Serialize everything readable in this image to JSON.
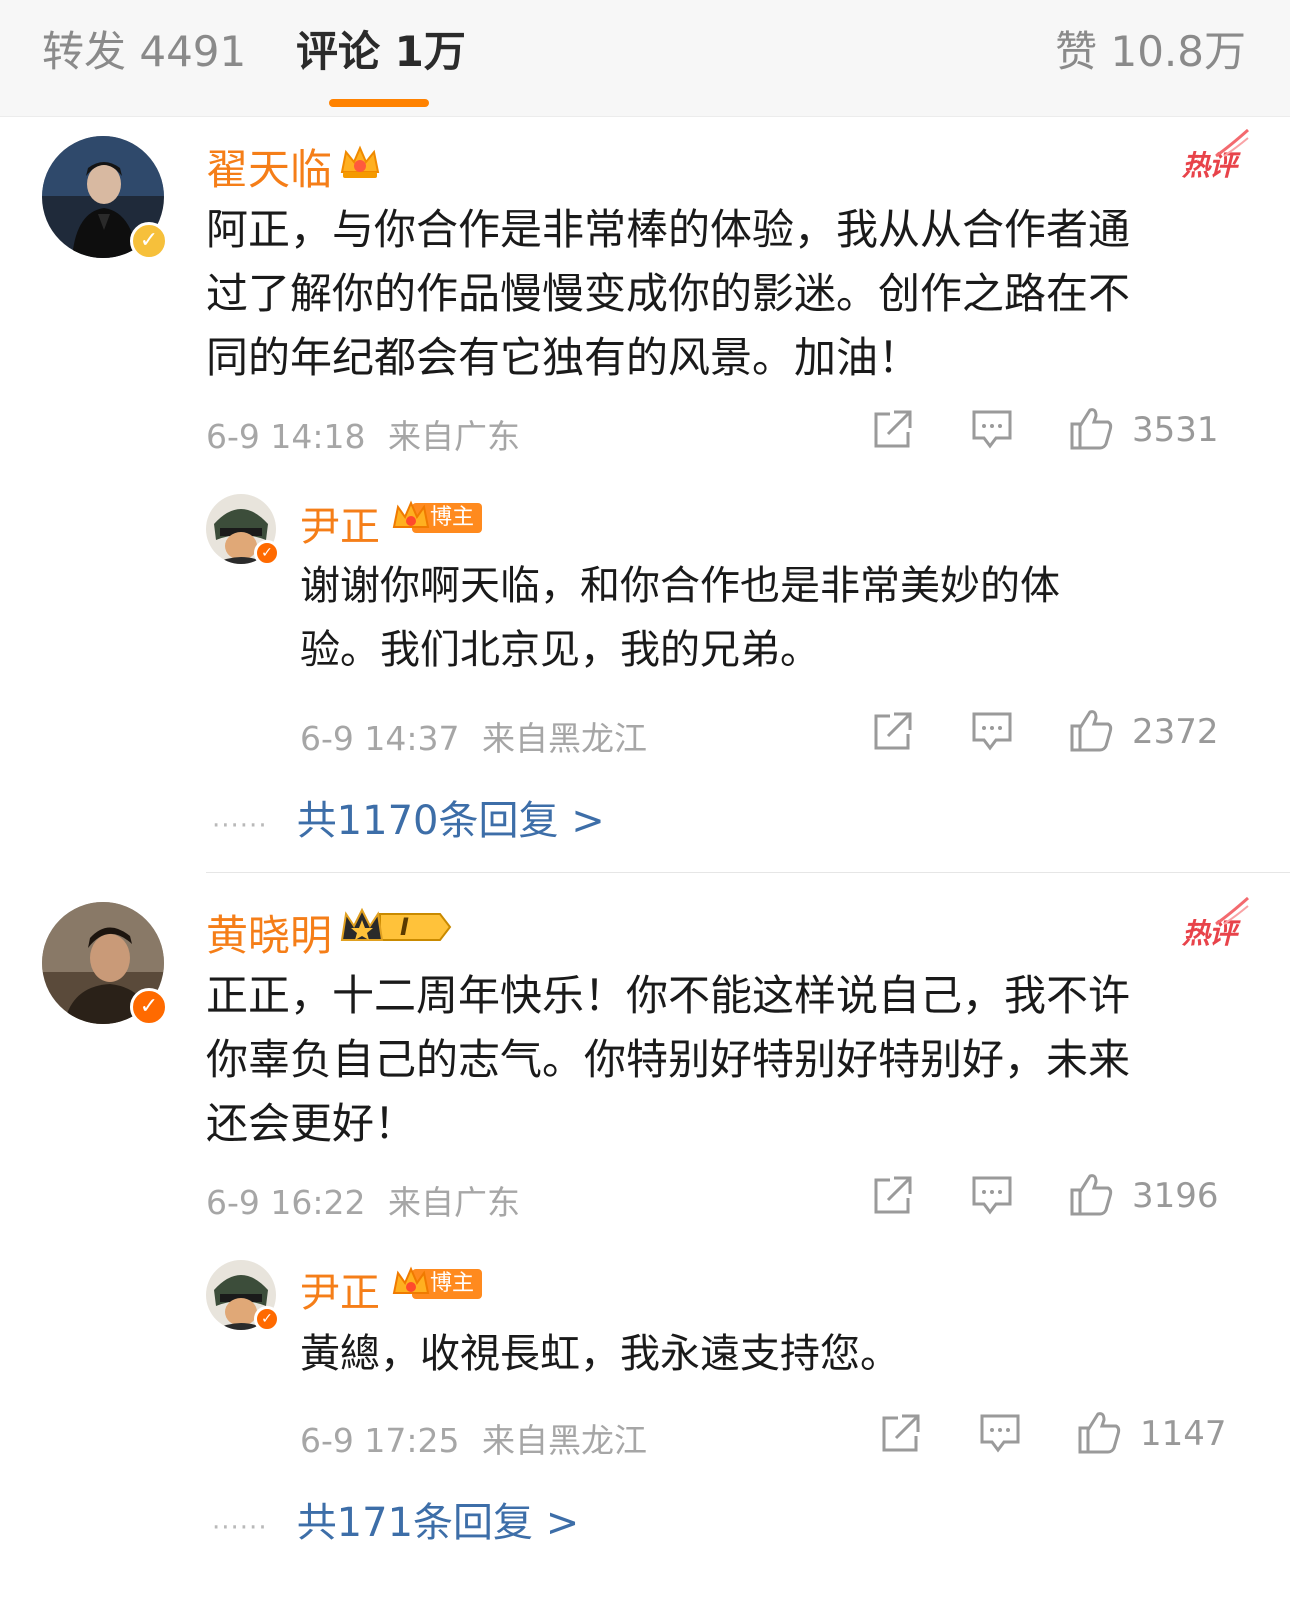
{
  "tabs": {
    "repost": "转发 4491",
    "comments": "评论 1万",
    "likes": "赞 10.8万"
  },
  "hot_label": "热评",
  "blogger_badge": "博主",
  "comments": [
    {
      "user": "翟天临",
      "text": "阿正，与你合作是非常棒的体验，我从从合作者通\n过了解你的作品慢慢变成你的影迷。创作之路在不\n同的年纪都会有它独有的风景。加油！",
      "time": "6-9 14:18",
      "location": "来自广东",
      "likes": "3531",
      "reply": {
        "user": "尹正",
        "text": "谢谢你啊天临，和你合作也是非常美妙的体\n验。我们北京见，我的兄弟。",
        "time": "6-9 14:37",
        "location": "来自黑龙江",
        "likes": "2372"
      },
      "more_replies": "共1170条回复 >"
    },
    {
      "user": "黄晓明",
      "level_badge": "I",
      "text": "正正，十二周年快乐！你不能这样说自己，我不许\n你辜负自己的志气。你特别好特别好特别好，未来\n还会更好！",
      "time": "6-9 16:22",
      "location": "来自广东",
      "likes": "3196",
      "reply": {
        "user": "尹正",
        "text": "黃總，收視長虹，我永遠支持您。",
        "time": "6-9 17:25",
        "location": "来自黑龙江",
        "likes": "1147"
      },
      "more_replies": "共171条回复 >"
    }
  ],
  "colors": {
    "accent": "#ff8200",
    "username": "#f57e18",
    "link": "#3d6ea8",
    "hot": "#e8434a",
    "verified": "#f6c03b",
    "verified_orange": "#ff6a00"
  }
}
